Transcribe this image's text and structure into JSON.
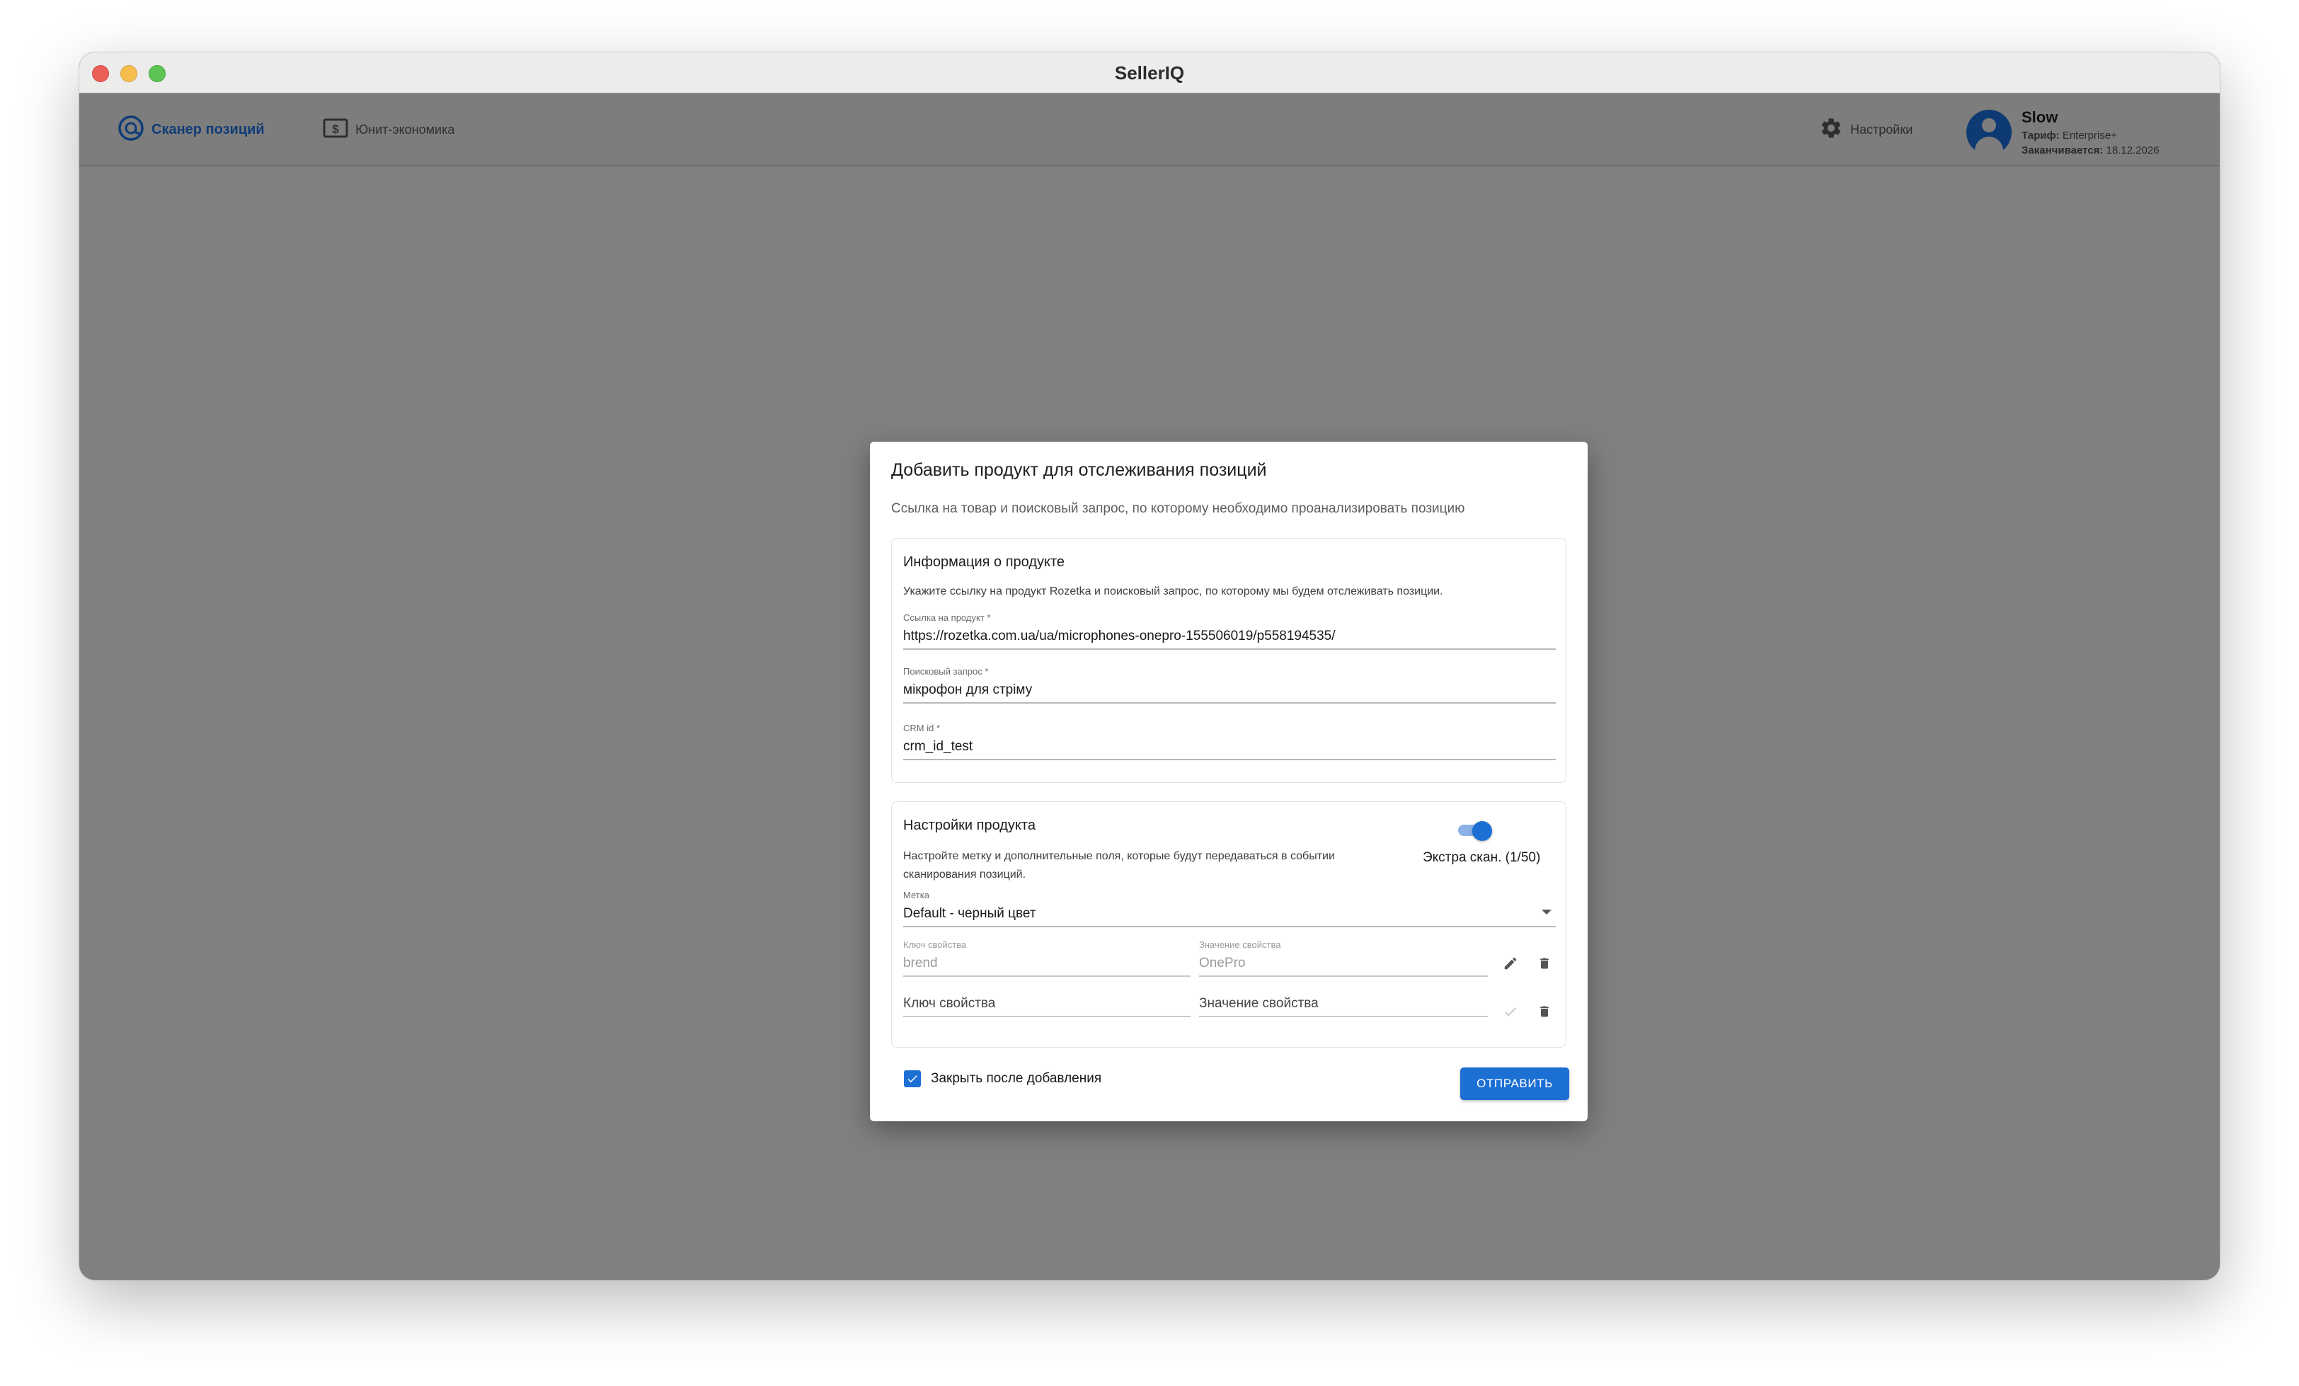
{
  "window": {
    "title": "SellerIQ"
  },
  "nav": {
    "scanner_label": "Сканер позиций",
    "unit_label": "Юнит-экономика",
    "settings_label": "Настройки"
  },
  "profile": {
    "name": "Slow",
    "plan_key": "Тариф:",
    "plan_value": "Enterprise+",
    "expires_key": "Заканчивается:",
    "expires_value": "18.12.2026"
  },
  "dialog": {
    "title": "Добавить продукт для отслеживания позиций",
    "subtitle": "Ссылка на товар и поисковый запрос, по которому необходимо проанализировать позицию",
    "product_info": {
      "title": "Информация о продукте",
      "description": "Укажите ссылку на продукт Rozetka и поисковый запрос, по которому мы будем отслеживать позиции.",
      "link_label": "Ссылка на продукт *",
      "link_value": "https://rozetka.com.ua/ua/microphones-onepro-155506019/p558194535/",
      "query_label": "Поисковый запрос *",
      "query_value": "мікрофон для стріму",
      "crm_label": "CRM id *",
      "crm_value": "crm_id_test"
    },
    "product_settings": {
      "title": "Настройки продукта",
      "description": "Настройте метку и дополнительные поля, которые будут передаваться в событии сканирования позиций.",
      "extra_scan_label": "Экстра скан. (1/50)",
      "extra_scan_enabled": true,
      "tag_label": "Метка",
      "tag_value": "Default - черный цвет",
      "properties": [
        {
          "key_label": "Ключ свойства",
          "key_value": "brend",
          "value_label": "Значение свойства",
          "value_value": "OnePro"
        }
      ],
      "new_key_placeholder": "Ключ свойства",
      "new_value_placeholder": "Значение свойства"
    },
    "close_after_add_label": "Закрыть после добавления",
    "close_after_add_checked": true,
    "submit_label": "ОТПРАВИТЬ"
  },
  "colors": {
    "accent": "#1c6fd3",
    "nav_active": "#103c77",
    "overlay": "#808080"
  }
}
